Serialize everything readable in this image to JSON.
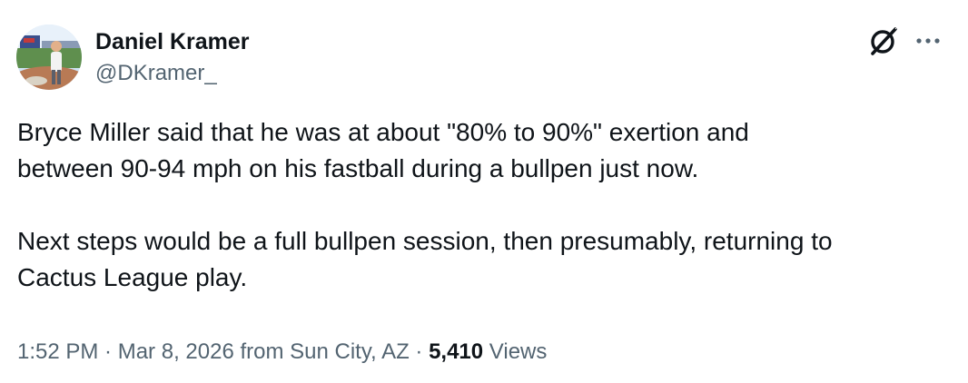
{
  "author": {
    "display_name": "Daniel Kramer",
    "handle": "@DKramer_"
  },
  "icons": {
    "avatar": "profile-photo",
    "grok": "grok-icon",
    "more": "more-dots-icon"
  },
  "tweet": {
    "paragraphs": [
      {
        "line1": "Bryce Miller said that he was at about \"80% to 90%\" exertion and",
        "line2": "between 90-94 mph on his fastball during a bullpen just now."
      },
      {
        "line1": "Next steps would be a full bullpen session, then presumably, returning to",
        "line2": "Cactus League play."
      }
    ]
  },
  "meta": {
    "time": "1:52 PM",
    "separator": " · ",
    "date": "Mar 8, 2026",
    "location": " from Sun City, AZ",
    "separator2": " · ",
    "views_count": "5,410",
    "views_label": " Views"
  },
  "colors": {
    "text_primary": "#0f1419",
    "text_secondary": "#536471"
  }
}
